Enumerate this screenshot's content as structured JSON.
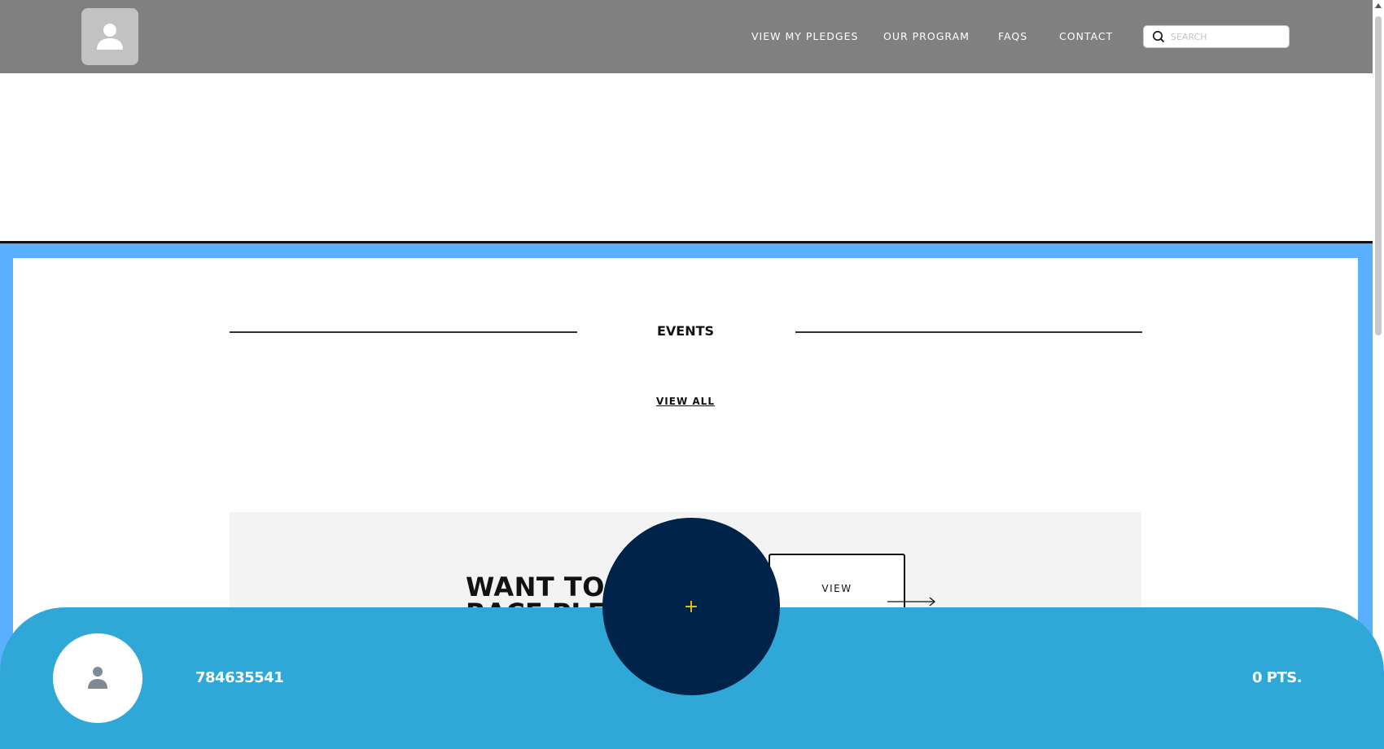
{
  "header": {
    "nav": [
      {
        "label": "VIEW MY PLEDGES"
      },
      {
        "label": "OUR PROGRAM"
      },
      {
        "label": "FAQS"
      },
      {
        "label": "CONTACT"
      }
    ],
    "search": {
      "placeholder": "SEARCH",
      "value": ""
    }
  },
  "main": {
    "events_title": "EVENTS",
    "view_all_label": "VIEW ALL",
    "promo": {
      "title_line1": "WANT TO S",
      "title_line2": "RACE PLED",
      "view_label": "VIEW"
    }
  },
  "footer_bar": {
    "user_id": "784635541",
    "points": "0 PTS.",
    "fab_symbol": "+"
  },
  "colors": {
    "header_bg": "#808080",
    "frame_blue": "#5aafff",
    "bottom_bar": "#2fa8d8",
    "fab_bg": "#00234a",
    "fab_plus": "#f3c022"
  }
}
